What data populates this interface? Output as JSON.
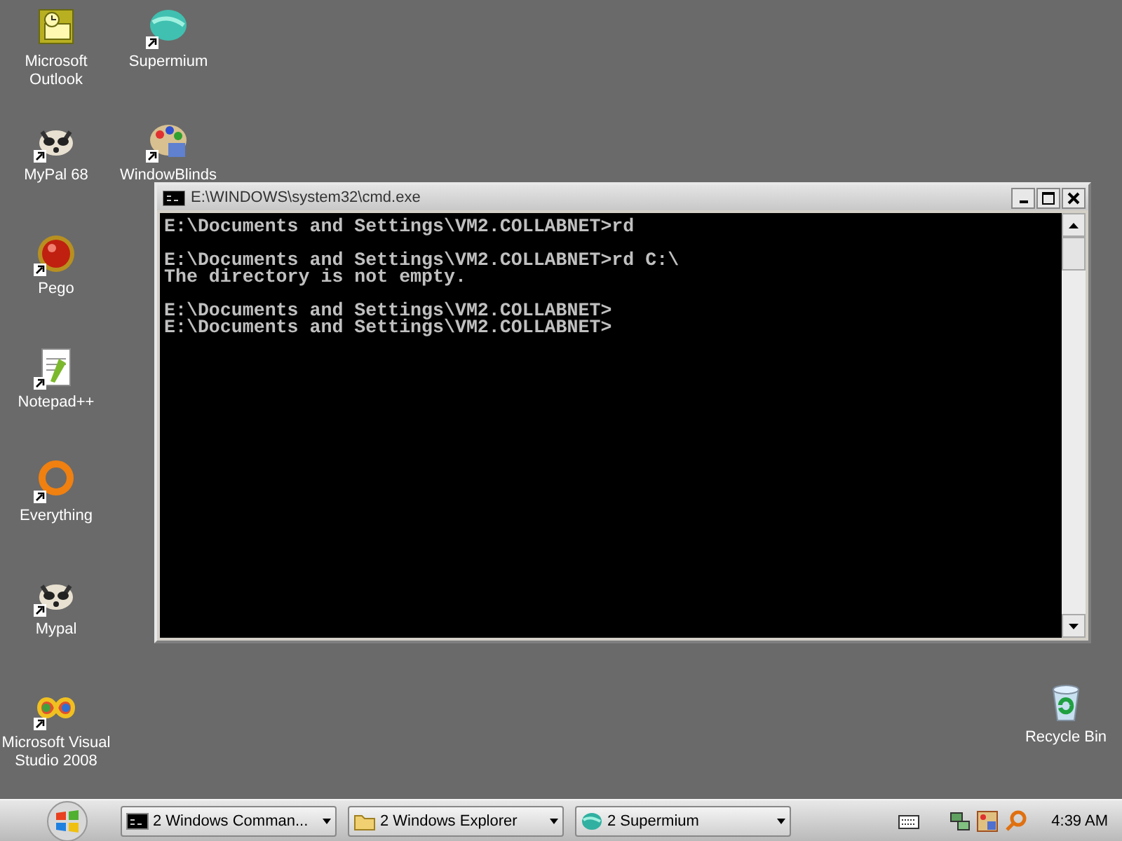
{
  "desktop": {
    "icon_columns": [
      [
        {
          "label": "Microsoft Outlook",
          "kind": "outlook",
          "shortcut": false
        },
        {
          "label": "MyPal 68",
          "kind": "raccoon",
          "shortcut": true
        },
        {
          "label": "Pego",
          "kind": "pego",
          "shortcut": true
        },
        {
          "label": "Notepad++",
          "kind": "notepad",
          "shortcut": true
        },
        {
          "label": "Everything",
          "kind": "everything",
          "shortcut": true
        },
        {
          "label": "Mypal",
          "kind": "raccoon",
          "shortcut": true
        },
        {
          "label": "Microsoft Visual Studio 2008",
          "kind": "visualstudio",
          "shortcut": true
        }
      ],
      [
        {
          "label": "Supermium",
          "kind": "supermium",
          "shortcut": true
        },
        {
          "label": "WindowBlinds",
          "kind": "palette",
          "shortcut": true
        }
      ]
    ],
    "corner_icon": {
      "label": "Recycle Bin",
      "kind": "recycle",
      "shortcut": false
    }
  },
  "window": {
    "title": "E:\\WINDOWS\\system32\\cmd.exe",
    "console_blocks": [
      [
        "E:\\Documents and Settings\\VM2.COLLABNET>rd"
      ],
      [
        "E:\\Documents and Settings\\VM2.COLLABNET>rd C:\\",
        "The directory is not empty."
      ],
      [
        "E:\\Documents and Settings\\VM2.COLLABNET>",
        "E:\\Documents and Settings\\VM2.COLLABNET>"
      ]
    ]
  },
  "taskbar": {
    "tasks": [
      {
        "label": "2 Windows Comman...",
        "kind": "console"
      },
      {
        "label": "2 Windows Explorer",
        "kind": "folder"
      },
      {
        "label": "2 Supermium",
        "kind": "supermium"
      }
    ],
    "tray_icons": [
      {
        "kind": "keyboard"
      },
      {
        "kind": "network"
      },
      {
        "kind": "palette"
      },
      {
        "kind": "search"
      }
    ],
    "clock": "4:39 AM"
  }
}
